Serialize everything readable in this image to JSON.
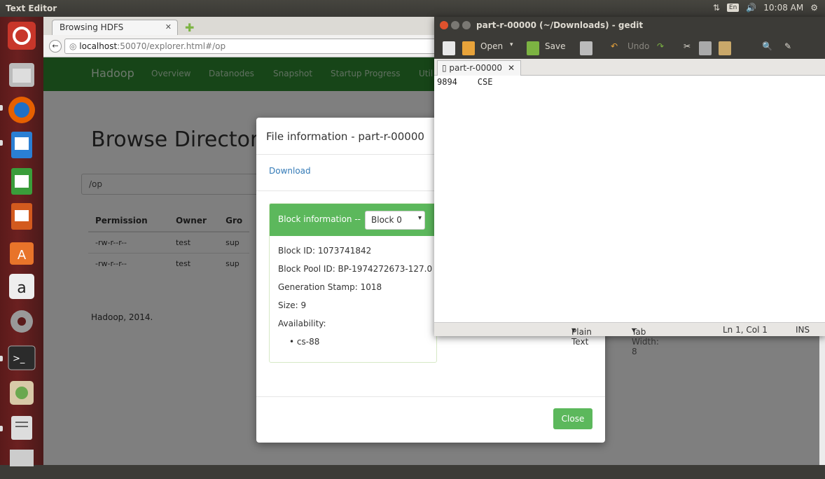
{
  "topbar": {
    "title": "Text Editor",
    "lang": "En",
    "time": "10:08 AM"
  },
  "browser": {
    "tab_title": "Browsing HDFS",
    "url_host": "localhost",
    "url_rest": ":50070/explorer.html#/op",
    "nav": {
      "brand": "Hadoop",
      "items": [
        "Overview",
        "Datanodes",
        "Snapshot",
        "Startup Progress",
        "Util"
      ]
    },
    "heading": "Browse Directory",
    "path": "/op",
    "table": {
      "headers": [
        "Permission",
        "Owner",
        "Gro"
      ],
      "rows": [
        [
          "-rw-r--r--",
          "test",
          "sup"
        ],
        [
          "-rw-r--r--",
          "test",
          "sup"
        ]
      ]
    },
    "footer": "Hadoop, 2014."
  },
  "modal": {
    "title": "File information - part-r-00000",
    "download": "Download",
    "block_label": "Block information --",
    "block_select": "Block 0",
    "block_id": "Block ID: 1073741842",
    "pool_id": "Block Pool ID: BP-1974272673-127.0",
    "gen_stamp": "Generation Stamp: 1018",
    "size": "Size: 9",
    "availability": "Availability:",
    "node": "cs-88",
    "close": "Close"
  },
  "gedit": {
    "title": "part-r-00000 (~/Downloads) - gedit",
    "open": "Open",
    "save": "Save",
    "undo": "Undo",
    "tab": "part-r-00000",
    "content": "9894\tCSE",
    "status": {
      "lang": "Plain Text",
      "tab_width": "Tab Width: 8",
      "pos": "Ln 1, Col 1",
      "mode": "INS"
    }
  }
}
